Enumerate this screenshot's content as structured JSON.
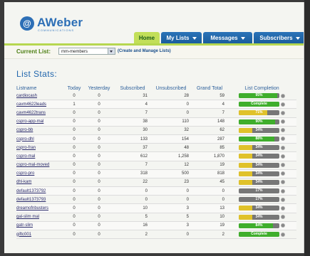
{
  "brand": {
    "logo_text": "AWeber",
    "logo_sub": "COMMUNICATIONS"
  },
  "tabs": [
    {
      "label": "Home"
    },
    {
      "label": "My Lists"
    },
    {
      "label": "Messages"
    },
    {
      "label": "Subscribers"
    }
  ],
  "current_list": {
    "label": "Current List:",
    "value": "mm-members",
    "manage_link": "(Create and Manage Lists)"
  },
  "page_title": "List Stats:",
  "table": {
    "headers": [
      "Listname",
      "Today",
      "Yesterday",
      "Subscribed",
      "Unsubscribed",
      "Grand Total",
      "List Completion"
    ],
    "rows": [
      {
        "name": "cardiocash",
        "today": "0",
        "yesterday": "0",
        "subscribed": "31",
        "unsubscribed": "28",
        "total": "59",
        "pct": 0.95,
        "label": "95%"
      },
      {
        "name": "cavm4622leads",
        "today": "1",
        "yesterday": "0",
        "subscribed": "4",
        "unsubscribed": "0",
        "total": "4",
        "pct": 1.0,
        "label": "Complete"
      },
      {
        "name": "cavm4622trans",
        "today": "0",
        "yesterday": "0",
        "subscribed": "7",
        "unsubscribed": "0",
        "total": "7",
        "pct": 0.71,
        "label": "71%"
      },
      {
        "name": "cspro-app-mal",
        "today": "0",
        "yesterday": "0",
        "subscribed": "38",
        "unsubscribed": "110",
        "total": "148",
        "pct": 0.9,
        "label": "90%"
      },
      {
        "name": "cspro-bb",
        "today": "0",
        "yesterday": "0",
        "subscribed": "30",
        "unsubscribed": "32",
        "total": "62",
        "pct": 0.34,
        "label": "34%"
      },
      {
        "name": "cspro-dhl",
        "today": "0",
        "yesterday": "0",
        "subscribed": "133",
        "unsubscribed": "154",
        "total": "287",
        "pct": 0.88,
        "label": "88%"
      },
      {
        "name": "cspro-fran",
        "today": "0",
        "yesterday": "0",
        "subscribed": "37",
        "unsubscribed": "48",
        "total": "85",
        "pct": 0.34,
        "label": "34%"
      },
      {
        "name": "cspro-mal",
        "today": "0",
        "yesterday": "0",
        "subscribed": "612",
        "unsubscribed": "1,258",
        "total": "1,870",
        "pct": 0.34,
        "label": "34%"
      },
      {
        "name": "cspro-mal-moved",
        "today": "0",
        "yesterday": "0",
        "subscribed": "7",
        "unsubscribed": "12",
        "total": "19",
        "pct": 0.34,
        "label": "34%"
      },
      {
        "name": "cspro-pro",
        "today": "0",
        "yesterday": "0",
        "subscribed": "318",
        "unsubscribed": "500",
        "total": "818",
        "pct": 0.34,
        "label": "34%"
      },
      {
        "name": "dhl-kam",
        "today": "0",
        "yesterday": "0",
        "subscribed": "22",
        "unsubscribed": "23",
        "total": "45",
        "pct": 0.34,
        "label": "34%"
      },
      {
        "name": "default1373792",
        "today": "0",
        "yesterday": "0",
        "subscribed": "0",
        "unsubscribed": "0",
        "total": "0",
        "pct": 0.0,
        "label": "17%"
      },
      {
        "name": "default1373793",
        "today": "0",
        "yesterday": "0",
        "subscribed": "0",
        "unsubscribed": "0",
        "total": "0",
        "pct": 0.0,
        "label": "17%"
      },
      {
        "name": "dreamofnbusters",
        "today": "0",
        "yesterday": "0",
        "subscribed": "10",
        "unsubscribed": "3",
        "total": "13",
        "pct": 0.34,
        "label": "34%"
      },
      {
        "name": "gal-slim mal",
        "today": "0",
        "yesterday": "0",
        "subscribed": "5",
        "unsubscribed": "5",
        "total": "10",
        "pct": 0.34,
        "label": "34%"
      },
      {
        "name": "gatr-slim",
        "today": "0",
        "yesterday": "0",
        "subscribed": "16",
        "unsubscribed": "3",
        "total": "19",
        "pct": 0.84,
        "label": "84%"
      },
      {
        "name": "giftc001",
        "today": "0",
        "yesterday": "0",
        "subscribed": "2",
        "unsubscribed": "0",
        "total": "2",
        "pct": 1.0,
        "label": "Complete"
      }
    ]
  },
  "colors": {
    "accent": "#2166ad",
    "home_tab": "#c2df59",
    "bar_green": "#3fae2c",
    "bar_yellow": "#e0c22a",
    "bar_empty": "#777777"
  }
}
